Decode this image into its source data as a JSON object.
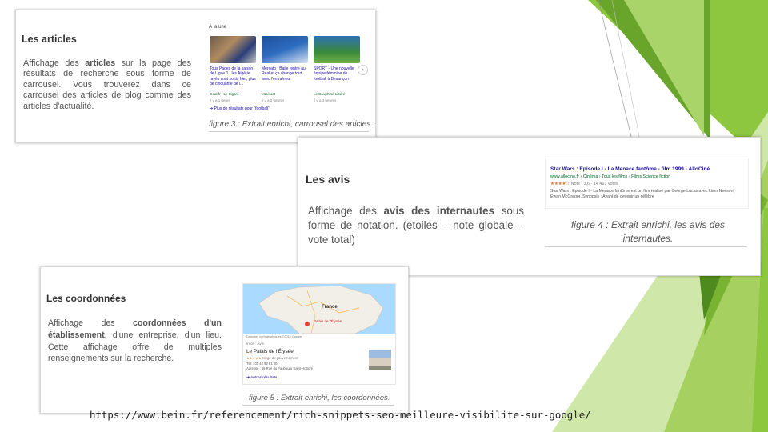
{
  "articles": {
    "heading": "Les articles",
    "paragraph_before": "Affichage des ",
    "paragraph_bold": "articles",
    "paragraph_after": " sur la page des résultats de recherche sous forme de carrousel. Vous trouverez dans ce carrousel des articles de blog comme des articles d'actualité.",
    "caption": "figure 3 : Extrait enrichi, carrousel des articles.",
    "carousel": {
      "header": "À la une",
      "cards": [
        {
          "title": "Tous Pages de la saison de Ligue 1 : les Algérie rayés sont sortis hier, plus de cinquante de l...",
          "source": "Goal.fr · Le Figaro",
          "time": "Il y a 1 heure"
        },
        {
          "title": "Mercato : Baile rentre au Real et ça change tout avec l'entraîneur",
          "source": "Maxifoot",
          "time": "Il y a 2 heures"
        },
        {
          "title": "SPORT - Une nouvelle équipe féminine de football à Besançon",
          "source": "Le Dauphiné Libéré",
          "time": "Il y a 3 heures"
        }
      ],
      "more_link": "Plus de résultats pour \"football\""
    }
  },
  "avis": {
    "heading": "Les avis",
    "paragraph_before": "Affichage des ",
    "paragraph_bold": "avis des internautes",
    "paragraph_after": " sous forme de notation. (étoiles – note globale – vote total)",
    "caption": "figure 4 : Extrait enrichi, les avis des internautes.",
    "snippet": {
      "title": "Star Wars : Episode I - La Menace fantôme - film 1999 - AlloCiné",
      "url": "www.allocine.fr › Cinéma › Tous les films › Films Science fiction",
      "rating": "Note : 3,6 - 14 463 votes",
      "desc": "Star Wars : Episode I - La Menace fantôme est un film réalisé par George Lucas avec Liam Neeson, Ewan McGregor. Synopsis : Avant de devenir un célèbre"
    }
  },
  "coordonnees": {
    "heading": "Les coordonnées",
    "paragraph_before": "Affichage des ",
    "paragraph_bold1": "coordonnées d'un établissement",
    "paragraph_after": ", d'une entreprise, d'un lieu. Cette affichage offre de multiples renseignements sur la recherche.",
    "caption": "figure 5 : Extrait enrichi, les coordonnées.",
    "map": {
      "country": "France",
      "place_label": "Palais de l'Élysée",
      "tabs": "Infos · Avis",
      "place_title": "Le Palais de l'Élysée",
      "place_type": "Siège du gouvernement",
      "address": "Adresse : 55 Rue du Faubourg Saint-Honoré",
      "phone": "Tél. : 01 42 92 81 00",
      "more": "Autres résultats",
      "footer": "Données cartographiques ©2019 Google"
    }
  },
  "source_url": "https://www.bein.fr/referencement/rich-snippets-seo-meilleure-visibilite-sur-google/",
  "colors": {
    "green_dark": "#4e8a1e",
    "green_mid": "#8dc63f",
    "green_light": "#cde6a4"
  }
}
